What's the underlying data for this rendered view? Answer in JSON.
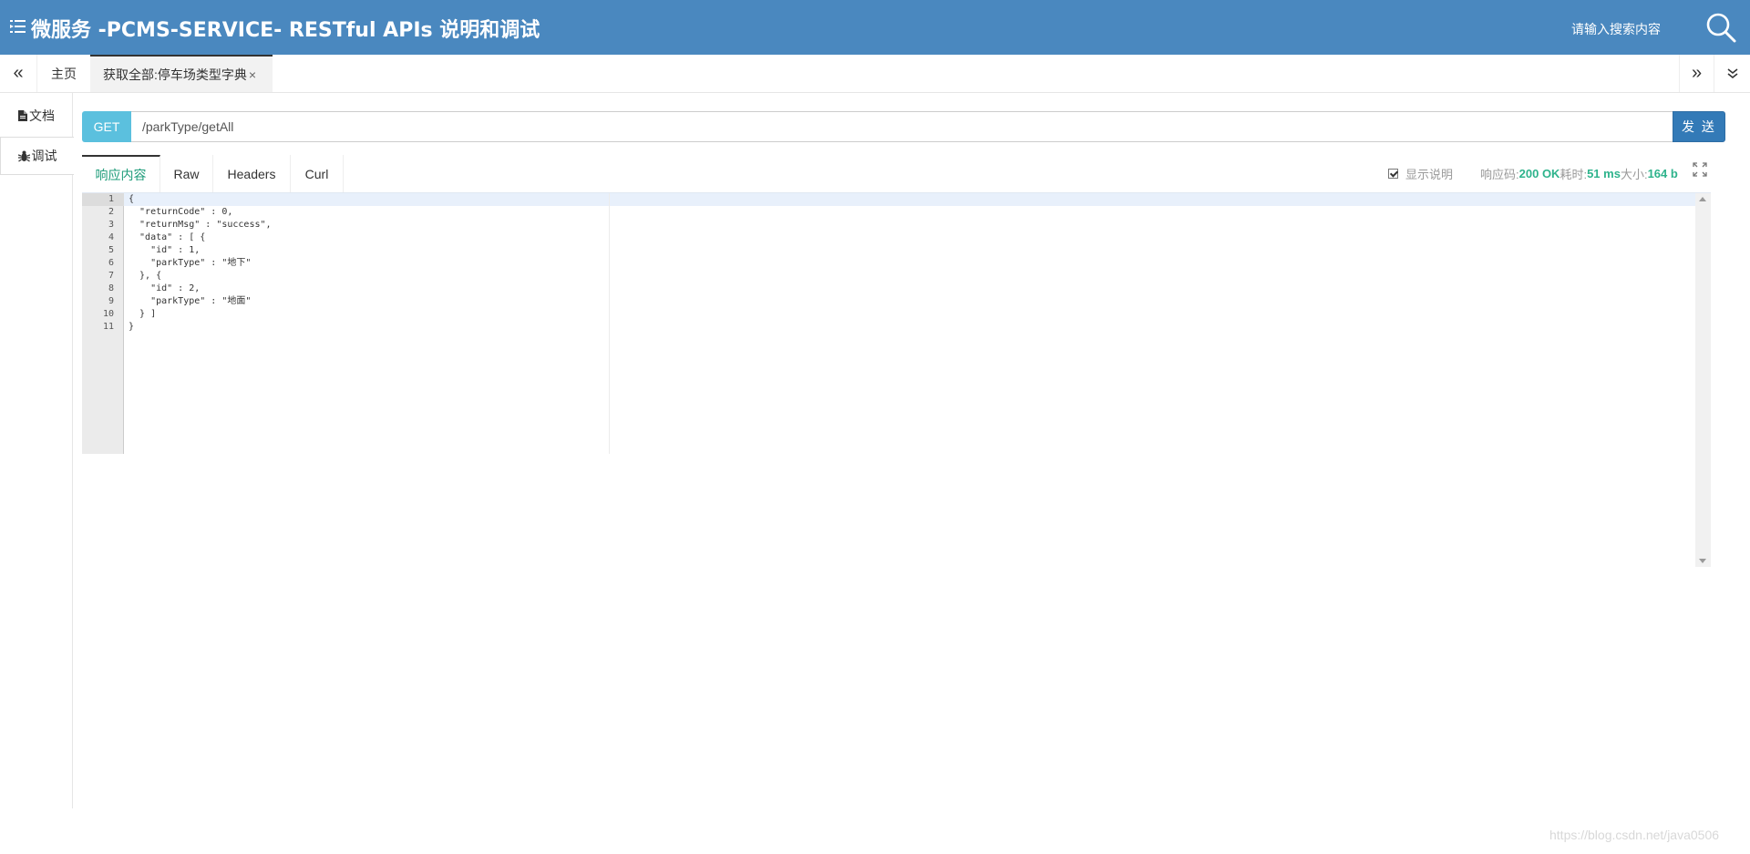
{
  "header": {
    "title": "微服务 -PCMS-SERVICE- RESTful APIs   说明和调试",
    "search_placeholder": "请输入搜索内容"
  },
  "tabs": {
    "home_label": "主页",
    "active_label": "获取全部:停车场类型字典",
    "close_glyph": "×"
  },
  "sidebar": {
    "doc_label": "文档",
    "debug_label": "调试"
  },
  "request": {
    "method": "GET",
    "url": "/parkType/getAll",
    "send_label": "发 送"
  },
  "response_tabs": [
    "响应内容",
    "Raw",
    "Headers",
    "Curl"
  ],
  "response_meta": {
    "show_desc_label": "显示说明",
    "code_label": "响应码:",
    "code_value": "200 OK",
    "time_label": "耗时:",
    "time_value": "51 ms",
    "size_label": "大小:",
    "size_value": "164 b"
  },
  "code_lines": [
    "{",
    "  \"returnCode\" : 0,",
    "  \"returnMsg\" : \"success\",",
    "  \"data\" : [ {",
    "    \"id\" : 1,",
    "    \"parkType\" : \"地下\"",
    "  }, {",
    "    \"id\" : 2,",
    "    \"parkType\" : \"地面\"",
    "  } ]",
    "}"
  ],
  "watermark": "https://blog.csdn.net/java0506",
  "colors": {
    "header_bg": "#4a88bf",
    "method_bg": "#5bc0de",
    "send_bg": "#337ab7",
    "status_green": "#2eb38c"
  }
}
